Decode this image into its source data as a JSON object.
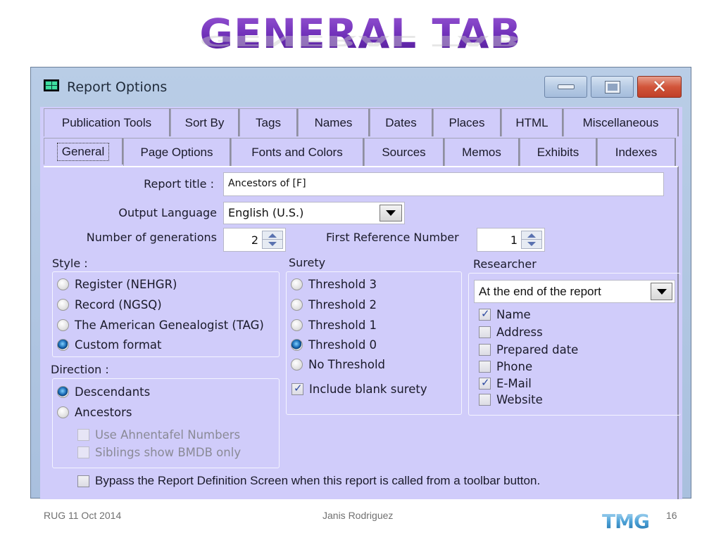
{
  "slide": {
    "title": "GENERAL TAB",
    "footer_left": "RUG 11 Oct 2014",
    "footer_center": "Janis Rodriguez",
    "footer_logo": "TMG",
    "page_number": "16"
  },
  "window": {
    "title": "Report Options",
    "icon": "report-options-icon",
    "controls": {
      "minimize": "minimize-icon",
      "maximize": "maximize-icon",
      "close": "close-icon"
    }
  },
  "tabs": {
    "back_row": [
      "Publication Tools",
      "Sort By",
      "Tags",
      "Names",
      "Dates",
      "Places",
      "HTML",
      "Miscellaneous"
    ],
    "front_row": [
      "General",
      "Page Options",
      "Fonts and Colors",
      "Sources",
      "Memos",
      "Exhibits",
      "Indexes"
    ],
    "active": "General"
  },
  "general": {
    "report_title_label": "Report title :",
    "report_title_value": "Ancestors of [F]",
    "output_language_label": "Output Language",
    "output_language_value": "English (U.S.)",
    "generations_label": "Number of generations",
    "generations_value": "2",
    "first_ref_label": "First Reference Number",
    "first_ref_value": "1"
  },
  "style": {
    "label": "Style :",
    "options": [
      {
        "label": "Register (NEHGR)",
        "selected": false
      },
      {
        "label": "Record (NGSQ)",
        "selected": false
      },
      {
        "label": "The American Genealogist (TAG)",
        "selected": false
      },
      {
        "label": "Custom format",
        "selected": true
      }
    ]
  },
  "direction": {
    "label": "Direction :",
    "options": [
      {
        "label": "Descendants",
        "selected": true
      },
      {
        "label": "Ancestors",
        "selected": false
      }
    ],
    "sub_options": [
      {
        "label": "Use Ahnentafel Numbers",
        "checked": false,
        "disabled": true
      },
      {
        "label": "Siblings show BMDB only",
        "checked": false,
        "disabled": true
      }
    ]
  },
  "surety": {
    "label": "Surety",
    "options": [
      {
        "label": "Threshold 3",
        "selected": false
      },
      {
        "label": "Threshold 2",
        "selected": false
      },
      {
        "label": "Threshold 1",
        "selected": false
      },
      {
        "label": "Threshold 0",
        "selected": true
      },
      {
        "label": "No Threshold",
        "selected": false
      }
    ],
    "include_blank": {
      "label": "Include blank surety",
      "checked": true
    }
  },
  "researcher": {
    "label": "Researcher",
    "position_value": "At the end of the report",
    "fields": [
      {
        "label": "Name",
        "checked": true
      },
      {
        "label": "Address",
        "checked": false
      },
      {
        "label": "Prepared date",
        "checked": false
      },
      {
        "label": "Phone",
        "checked": false
      },
      {
        "label": "E-Mail",
        "checked": true
      },
      {
        "label": "Website",
        "checked": false
      }
    ]
  },
  "bypass": {
    "label": "Bypass the Report Definition Screen when this report is called from a toolbar button.",
    "checked": false
  }
}
